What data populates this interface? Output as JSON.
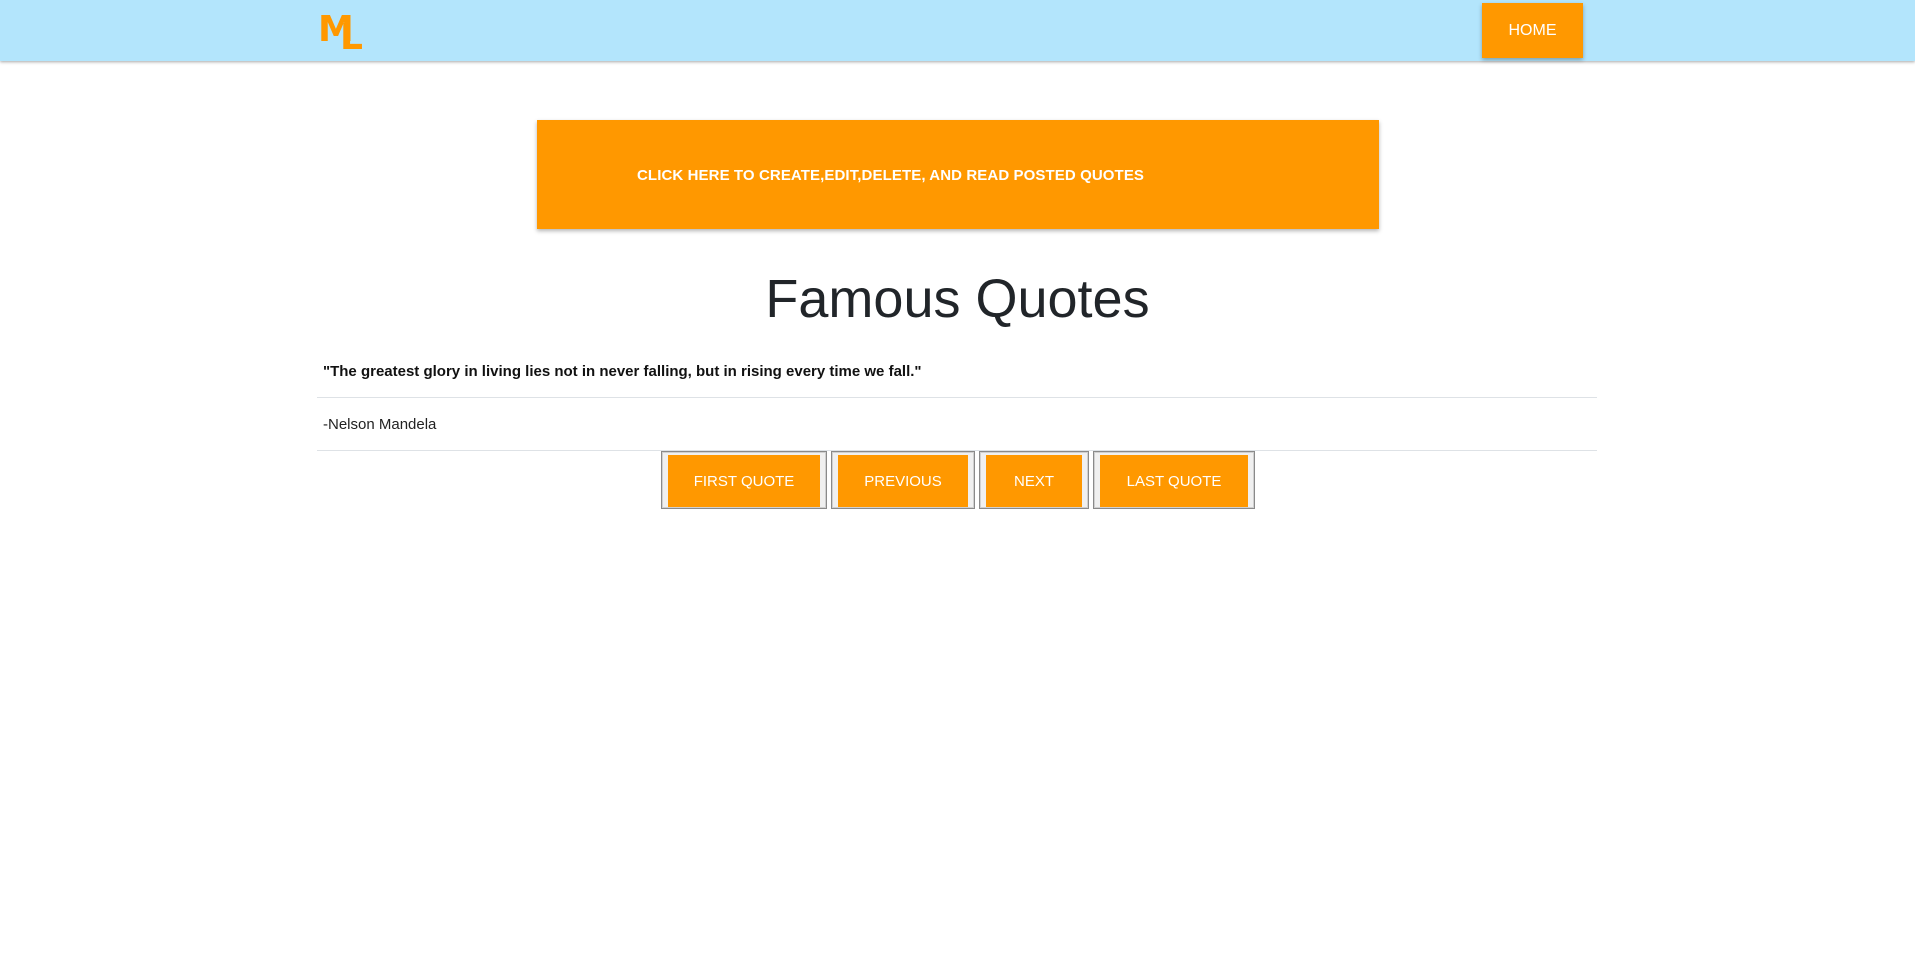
{
  "header": {
    "logo_text_m": "M",
    "logo_text_l": "L",
    "home_label": "HOME"
  },
  "banner": {
    "label": "CLICK HERE TO CREATE,EDIT,DELETE, AND READ POSTED QUOTES"
  },
  "main": {
    "title": "Famous Quotes",
    "quote": "\"The greatest glory in living lies not in never falling, but in rising every time we fall.\"",
    "author": "-Nelson Mandela"
  },
  "pager": {
    "first_label": "FIRST QUOTE",
    "previous_label": "PREVIOUS",
    "next_label": "NEXT",
    "last_label": "LAST QUOTE"
  },
  "colors": {
    "navbar_bg": "#b3e5fc",
    "accent": "#ff9800",
    "button_text": "#ffffff"
  }
}
